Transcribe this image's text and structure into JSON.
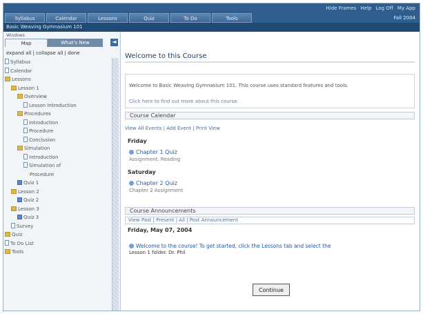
{
  "header": {
    "top_links": [
      "Hide Frames",
      "Help",
      "Log Off",
      "My App"
    ],
    "tabs": [
      "Syllabus",
      "Calendar",
      "Lessons",
      "Quiz",
      "To Do",
      "Tools"
    ],
    "term": "Fall 2004"
  },
  "course_title": "Basic Weaving Gymnasium 101",
  "left": {
    "window_label": "Windows",
    "tabs": [
      "Map",
      "What's New"
    ],
    "collapse_icon": "◄",
    "expand_collapse": "expand all | collapse all | done",
    "tree": [
      {
        "label": "Syllabus",
        "icon": "doc",
        "indent": 0
      },
      {
        "label": "Calendar",
        "icon": "doc",
        "indent": 0
      },
      {
        "label": "Lessons",
        "icon": "folder",
        "indent": 0
      },
      {
        "label": "Lesson 1",
        "icon": "folder",
        "indent": 1
      },
      {
        "label": "Overview",
        "icon": "folder",
        "indent": 2
      },
      {
        "label": "Lesson Introduction",
        "icon": "doc",
        "indent": 3
      },
      {
        "label": "Procedures",
        "icon": "folder",
        "indent": 2
      },
      {
        "label": "Introduction",
        "icon": "doc",
        "indent": 3
      },
      {
        "label": "Procedure",
        "icon": "doc",
        "indent": 3
      },
      {
        "label": "Conclusion",
        "icon": "doc",
        "indent": 3
      },
      {
        "label": "Simulation",
        "icon": "folder",
        "indent": 2
      },
      {
        "label": "Introduction",
        "icon": "doc",
        "indent": 3
      },
      {
        "label": "Simulation of",
        "icon": "doc",
        "indent": 3
      },
      {
        "label": "Procedure",
        "icon": "none",
        "indent": 4
      },
      {
        "label": "Quiz 1",
        "icon": "quiz",
        "indent": 2
      },
      {
        "label": "Lesson 2",
        "icon": "folder",
        "indent": 1
      },
      {
        "label": "Quiz 2",
        "icon": "quiz",
        "indent": 2
      },
      {
        "label": "Lesson 3",
        "icon": "folder",
        "indent": 1
      },
      {
        "label": "Quiz 3",
        "icon": "quiz",
        "indent": 2
      },
      {
        "label": "Survey",
        "icon": "doc",
        "indent": 1
      },
      {
        "label": "Quiz",
        "icon": "folder",
        "indent": 0
      },
      {
        "label": "To Do List",
        "icon": "doc",
        "indent": 0
      },
      {
        "label": "Tools",
        "icon": "folder",
        "indent": 0
      }
    ]
  },
  "main": {
    "page_title": "Welcome to this Course",
    "welcome_text": "Welcome to Basic Weaving Gymnasium 101. This course uses standard features and tools.",
    "welcome_link": "Click here to find out more about this course.",
    "calendar": {
      "section_title": "Course Calendar",
      "links": "View All Events | Add Event | Print View",
      "days": [
        {
          "day": "Friday",
          "event": "Chapter 1 Quiz",
          "sub": "Assignment: Reading"
        },
        {
          "day": "Saturday",
          "event": "Chapter 2 Quiz",
          "sub": "Chapter 2 Assignment"
        }
      ]
    },
    "announcements": {
      "section_title": "Course Announcements",
      "toolbar": "View Past | Present | All | Post Announcement",
      "date": "Friday, May 07, 2004",
      "line1": "Welcome to the course! To get started, click the Lessons tab and select the",
      "line2": "Lesson 1 folder. Dr. Phil"
    },
    "continue_label": "Continue"
  }
}
